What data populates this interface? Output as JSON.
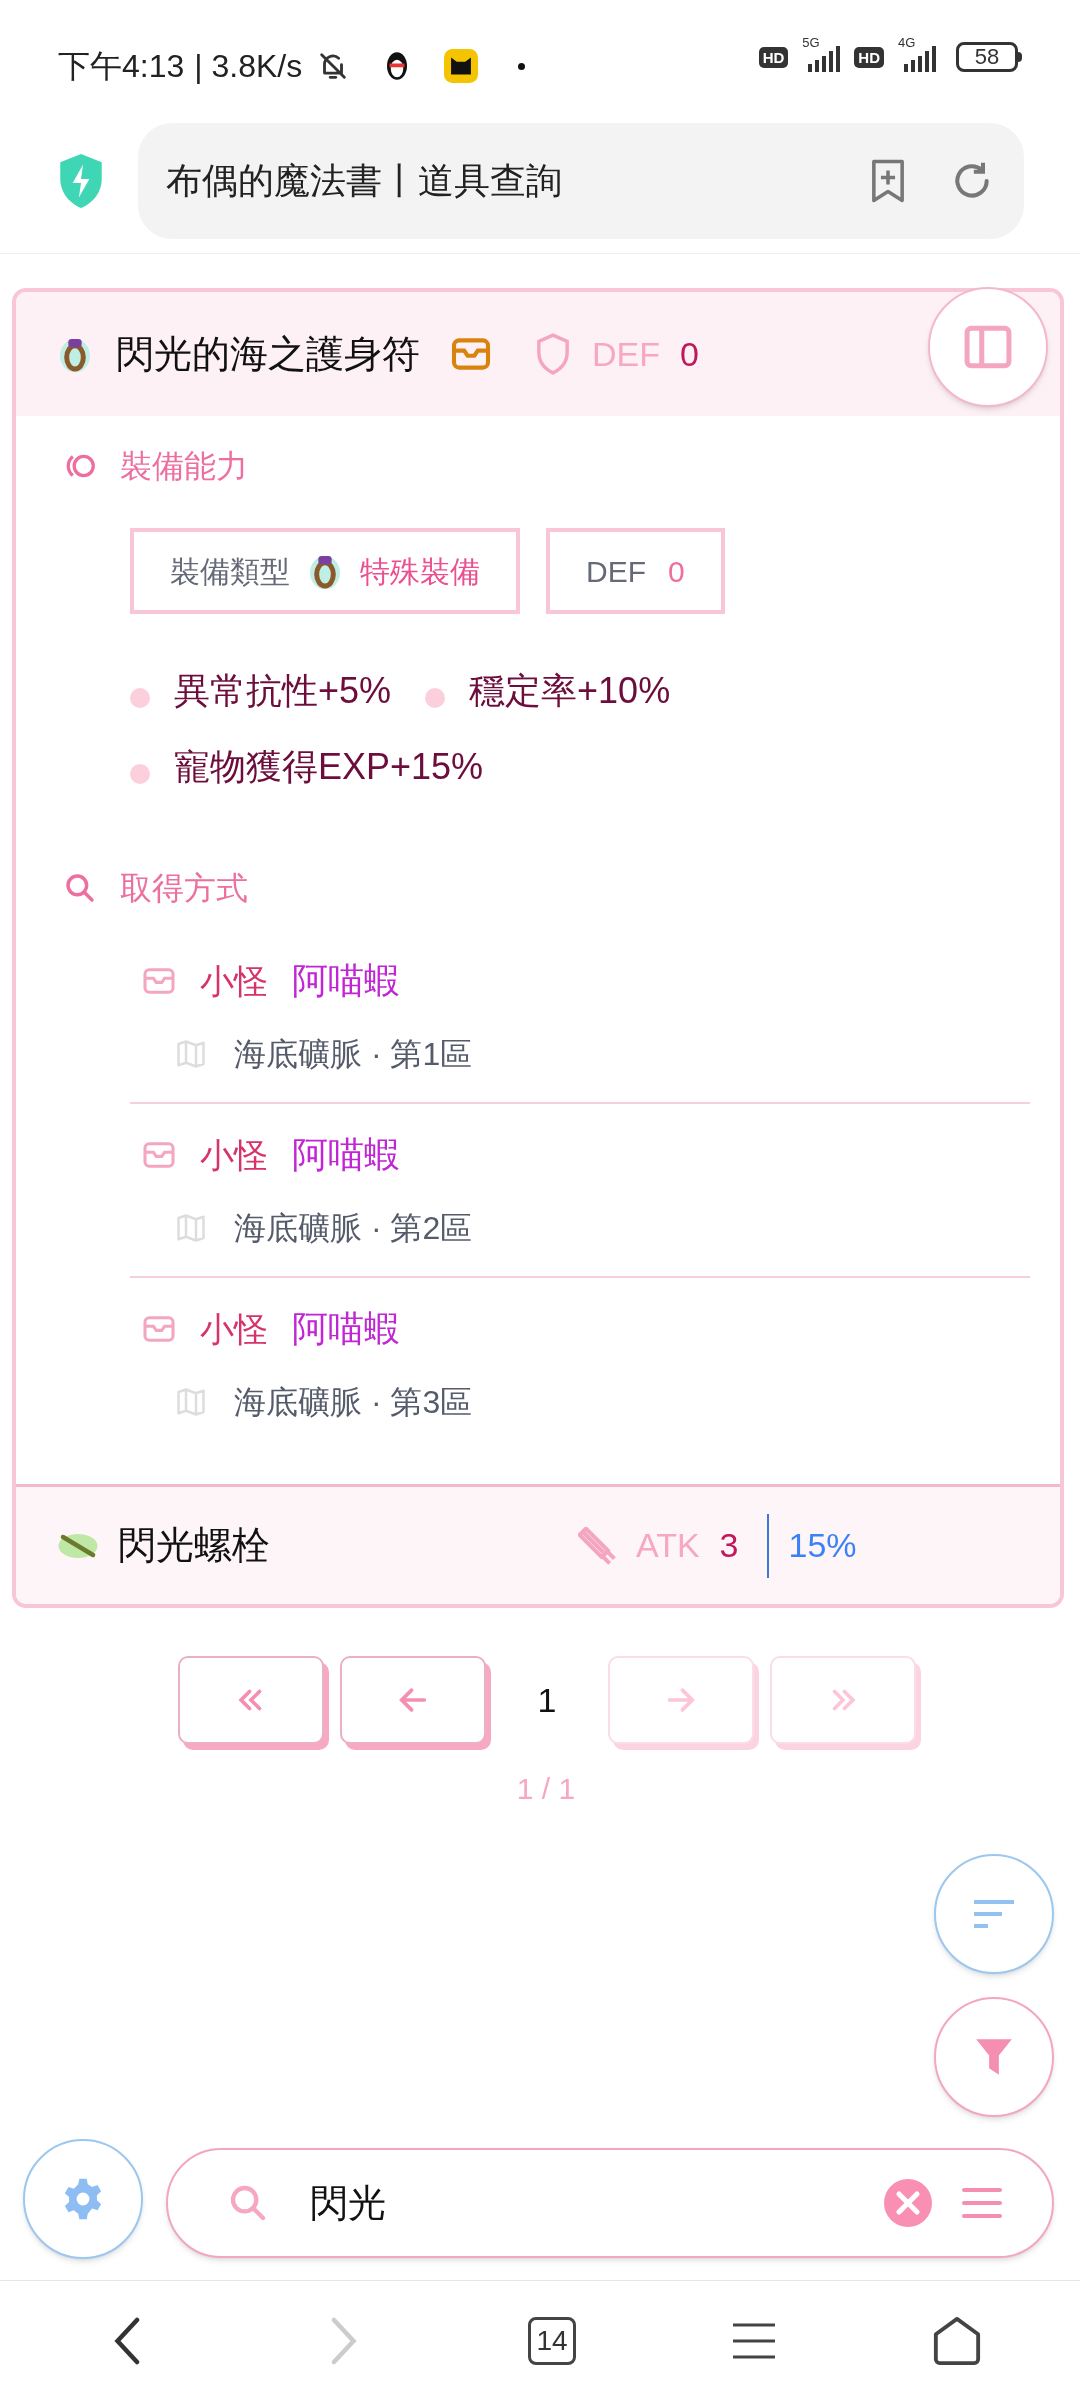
{
  "status_bar": {
    "time": "下午4:13",
    "speed": "| 3.8K/s",
    "network": [
      {
        "badge": "HD",
        "type": "5G"
      },
      {
        "badge": "HD",
        "type": "4G"
      }
    ],
    "battery": "58"
  },
  "address_bar": {
    "title": "布偶的魔法書丨道具查詢"
  },
  "item_card": {
    "name": "閃光的海之護身符",
    "stat_label": "DEF",
    "stat_value": "0",
    "equipment_heading": "裝備能力",
    "type_label": "裝備類型",
    "type_value": "特殊裝備",
    "def_label": "DEF",
    "def_value": "0",
    "bonuses": [
      "異常抗性+5%",
      "穩定率+10%",
      "寵物獲得EXP+15%"
    ],
    "acquire_heading": "取得方式",
    "sources": [
      {
        "kind": "小怪",
        "monster": "阿喵蝦",
        "location": "海底礦脈 · 第1區"
      },
      {
        "kind": "小怪",
        "monster": "阿喵蝦",
        "location": "海底礦脈 · 第2區"
      },
      {
        "kind": "小怪",
        "monster": "阿喵蝦",
        "location": "海底礦脈 · 第3區"
      }
    ]
  },
  "next_item": {
    "name": "閃光螺栓",
    "stat_label": "ATK",
    "stat_value": "3",
    "rate": "15%"
  },
  "pagination": {
    "buttons": [
      {
        "kind": "first",
        "disabled": false
      },
      {
        "kind": "prev",
        "disabled": false
      },
      {
        "kind": "next",
        "disabled": true
      },
      {
        "kind": "last",
        "disabled": true
      }
    ],
    "current": "1",
    "summary": "1 / 1"
  },
  "search": {
    "value": "閃光"
  },
  "browser_nav": {
    "back_disabled": false,
    "forward_disabled": true,
    "tabs": "14"
  }
}
